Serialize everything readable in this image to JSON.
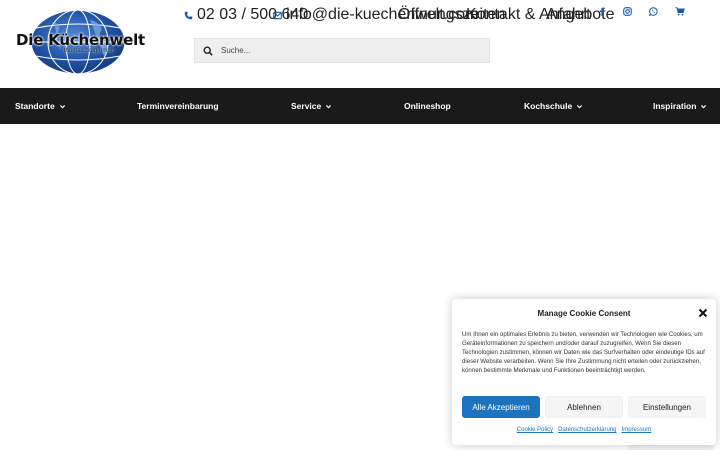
{
  "brand": {
    "name": "Die Küchenwelt",
    "subtitle": "thomas brag gmbh",
    "globe_color": "#1e4fa0"
  },
  "topbar": {
    "phone": "02 03 / 500 640",
    "email": "info@die-kuechenwelt.com",
    "links": [
      "Öffnungszeiten",
      "Kontakt & Anfahrt",
      "Angebote"
    ],
    "icons": [
      "facebook-icon",
      "instagram-icon",
      "whatsapp-icon",
      "cart-icon"
    ],
    "accent": "#1e5aa8"
  },
  "search": {
    "placeholder": "Suche..."
  },
  "nav": {
    "background": "#1a1a1a",
    "items": [
      {
        "label": "Standorte",
        "dropdown": true
      },
      {
        "label": "Terminvereinbarung",
        "dropdown": false
      },
      {
        "label": "Service",
        "dropdown": true
      },
      {
        "label": "Onlineshop",
        "dropdown": false
      },
      {
        "label": "Kochschule",
        "dropdown": true
      },
      {
        "label": "Inspiration",
        "dropdown": true
      }
    ]
  },
  "cookie": {
    "title": "Manage Cookie Consent",
    "text": "Um Ihnen ein optimales Erlebnis zu bieten, verwenden wir Technologien wie Cookies, um Geräteinformationen zu speichern und/oder darauf zuzugreifen. Wenn Sie diesen Technologien zustimmen, können wir Daten wie das Surfverhalten oder eindeutige IDs auf dieser Website verarbeiten. Wenn Sie Ihre Zustimmung nicht erteilen oder zurückziehen, können bestimmte Merkmale und Funktionen beeinträchtigt werden.",
    "accept_label": "Alle Akzeptieren",
    "deny_label": "Ablehnen",
    "settings_label": "Einstellungen",
    "links": [
      "Cookie Policy",
      "Datenschutzerklärung",
      "Impressum"
    ],
    "accent": "#1e73be"
  }
}
